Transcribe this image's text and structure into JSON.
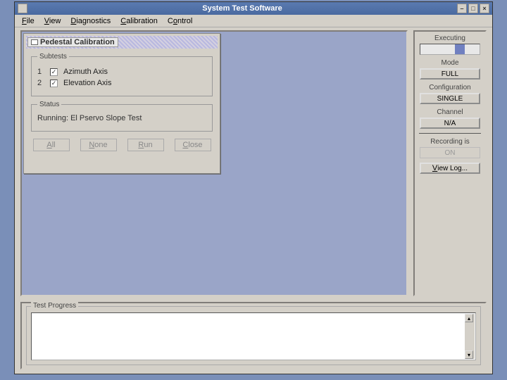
{
  "window": {
    "title": "System Test Software",
    "minimize": "–",
    "maximize": "□",
    "close": "×"
  },
  "menubar": {
    "file": "File",
    "view": "View",
    "diagnostics": "Diagnostics",
    "calibration": "Calibration",
    "control": "Control"
  },
  "dialog": {
    "title": "Pedestal Calibration",
    "subtests_legend": "Subtests",
    "subtest1_num": "1",
    "subtest1_label": "Azimuth Axis",
    "subtest1_checked": "✓",
    "subtest2_num": "2",
    "subtest2_label": "Elevation Axis",
    "subtest2_checked": "✓",
    "status_legend": "Status",
    "status_text": "Running: El Pservo Slope Test",
    "btn_all": "All",
    "btn_none": "None",
    "btn_run": "Run",
    "btn_close": "Close"
  },
  "side": {
    "executing": "Executing",
    "mode_label": "Mode",
    "mode_value": "FULL",
    "config_label": "Configuration",
    "config_value": "SINGLE",
    "channel_label": "Channel",
    "channel_value": "N/A",
    "recording_label": "Recording is",
    "recording_value": "ON",
    "viewlog": "View Log..."
  },
  "bottom": {
    "legend": "Test Progress",
    "up": "▴",
    "down": "▾"
  }
}
